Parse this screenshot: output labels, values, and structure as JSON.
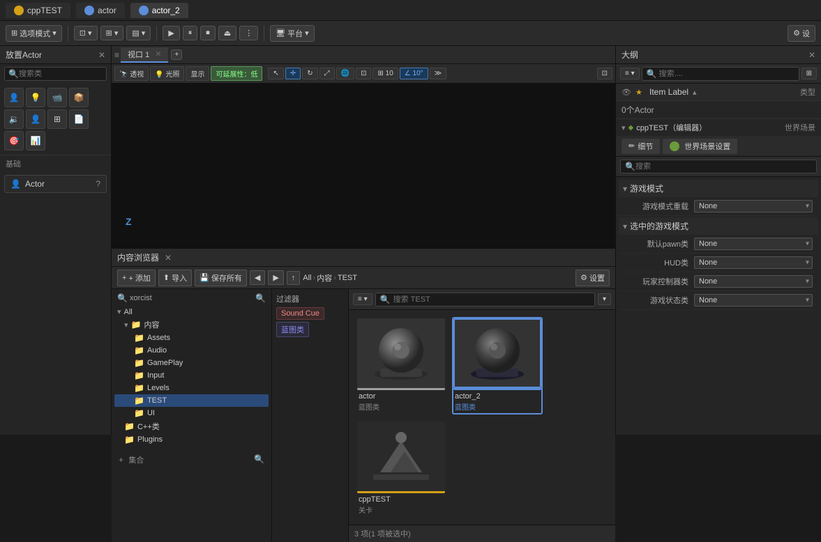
{
  "titlebar": {
    "tabs": [
      {
        "id": "cppTEST",
        "label": "cppTEST",
        "icon": "yellow",
        "active": false
      },
      {
        "id": "actor",
        "label": "actor",
        "icon": "blue",
        "active": false
      },
      {
        "id": "actor_2",
        "label": "actor_2",
        "icon": "blue",
        "active": true
      }
    ]
  },
  "toolbar": {
    "mode_btn": "选项模式",
    "platform_btn": "平台",
    "settings_btn": "设"
  },
  "left_panel": {
    "title": "放置Actor",
    "search_placeholder": "搜索类",
    "section_label": "基础",
    "actor_label": "Actor"
  },
  "viewport": {
    "tab_label": "视口 1",
    "buttons": [
      "透视",
      "光照",
      "显示",
      "可延展性：低"
    ],
    "axis_label": "Z"
  },
  "content_browser": {
    "title": "内容浏览器",
    "add_btn": "+ 添加",
    "import_btn": "导入",
    "save_btn": "保存所有",
    "settings_btn": "设置",
    "path": [
      "All",
      "内容",
      "TEST"
    ],
    "search_placeholder": "搜索 TEST",
    "folder_tree": {
      "roots": [
        {
          "label": "All",
          "indent": 0
        },
        {
          "label": "内容",
          "indent": 1
        },
        {
          "label": "Assets",
          "indent": 2
        },
        {
          "label": "Audio",
          "indent": 2
        },
        {
          "label": "GamePlay",
          "indent": 2
        },
        {
          "label": "Input",
          "indent": 2
        },
        {
          "label": "Levels",
          "indent": 2
        },
        {
          "label": "TEST",
          "indent": 2,
          "selected": true
        },
        {
          "label": "UI",
          "indent": 2
        },
        {
          "label": "C++类",
          "indent": 1
        },
        {
          "label": "Plugins",
          "indent": 1
        }
      ],
      "bottom_label": "集合"
    },
    "filter_label": "过滤器",
    "filter_tags": [
      {
        "label": "Sound Cue",
        "style": "red"
      },
      {
        "label": "蓝图类",
        "style": "purple"
      }
    ],
    "assets": [
      {
        "id": "actor",
        "name": "actor",
        "type": "蓝图类",
        "type_style": "normal",
        "selected": false,
        "bar_color": "#a0a0a0"
      },
      {
        "id": "actor_2",
        "name": "actor_2",
        "type": "蓝图类",
        "type_style": "blue",
        "selected": true,
        "bar_color": "#5b8dd9"
      },
      {
        "id": "cppTEST",
        "name": "cppTEST",
        "type": "关卡",
        "type_style": "normal",
        "selected": false,
        "bar_color": "#d4a017"
      }
    ],
    "count_label": "3 项(1 项被选中)"
  },
  "outline": {
    "title": "大纲",
    "search_placeholder": "搜索....",
    "item_label": "Item Label",
    "type_col": "类型",
    "world_col": "世界场景",
    "world_item": "cppTEST（编辑器）",
    "actor_count": "0个Actor"
  },
  "details": {
    "tab1": "细节",
    "tab2": "世界场景设置",
    "search_placeholder": "搜索",
    "sections": [
      {
        "label": "游戏模式",
        "rows": [
          {
            "label": "游戏模式重载",
            "value": "None"
          }
        ]
      },
      {
        "label": "选中的游戏模式",
        "rows": [
          {
            "label": "默认pawn类",
            "value": "None"
          },
          {
            "label": "HUD类",
            "value": "None"
          },
          {
            "label": "玩家控制器类",
            "value": "None"
          },
          {
            "label": "游戏状态类",
            "value": "None"
          }
        ]
      }
    ]
  }
}
